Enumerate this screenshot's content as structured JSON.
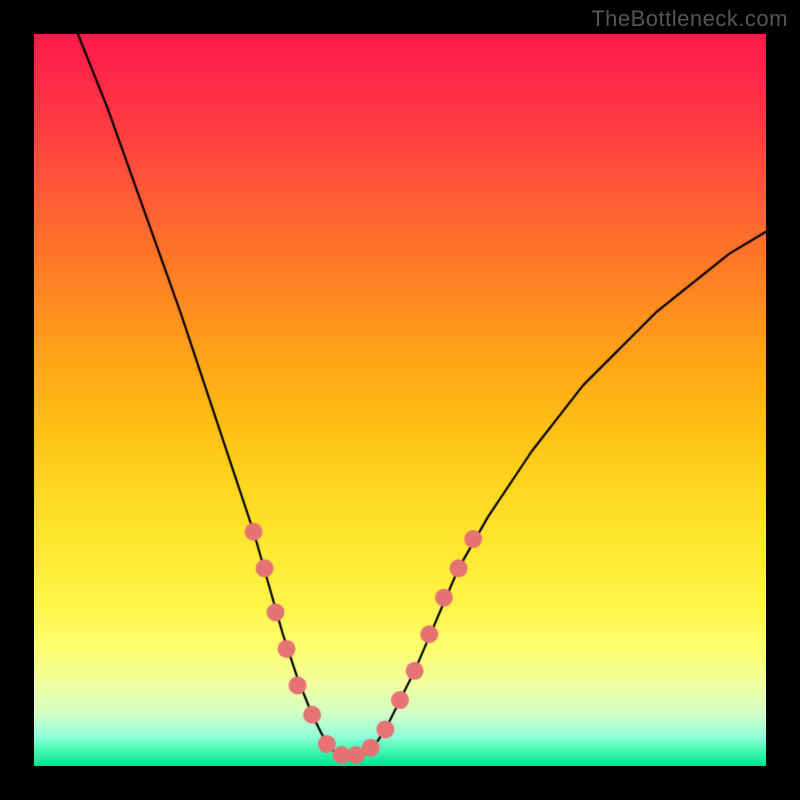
{
  "watermark": "TheBottleneck.com",
  "chart_data": {
    "type": "line",
    "title": "",
    "xlabel": "",
    "ylabel": "",
    "xlim": [
      0,
      100
    ],
    "ylim": [
      0,
      100
    ],
    "grid": false,
    "legend": false,
    "description": "V-shaped bottleneck curve over rainbow gradient (red=top/bad, green=bottom/good). Curve dips to ~0 near x≈40–45 then rises.",
    "series": [
      {
        "name": "bottleneck-curve",
        "color": "#000000",
        "x": [
          6,
          10,
          15,
          20,
          25,
          28,
          30,
          32,
          34,
          36,
          38,
          40,
          42,
          44,
          46,
          48,
          50,
          52,
          55,
          58,
          62,
          68,
          75,
          85,
          95,
          100
        ],
        "values": [
          100,
          90,
          76,
          62,
          47,
          38,
          32,
          25,
          18,
          12,
          7,
          3,
          1,
          1,
          2,
          5,
          9,
          13,
          20,
          27,
          34,
          43,
          52,
          62,
          70,
          73
        ]
      }
    ],
    "markers": {
      "name": "data-points",
      "color": "#e57373",
      "radius": 9,
      "points": [
        {
          "x": 30,
          "y": 32
        },
        {
          "x": 31.5,
          "y": 27
        },
        {
          "x": 33,
          "y": 21
        },
        {
          "x": 34.5,
          "y": 16
        },
        {
          "x": 36,
          "y": 11
        },
        {
          "x": 38,
          "y": 7
        },
        {
          "x": 40,
          "y": 3
        },
        {
          "x": 42,
          "y": 1.5
        },
        {
          "x": 44,
          "y": 1.5
        },
        {
          "x": 46,
          "y": 2.5
        },
        {
          "x": 48,
          "y": 5
        },
        {
          "x": 50,
          "y": 9
        },
        {
          "x": 52,
          "y": 13
        },
        {
          "x": 54,
          "y": 18
        },
        {
          "x": 56,
          "y": 23
        },
        {
          "x": 58,
          "y": 27
        },
        {
          "x": 60,
          "y": 31
        }
      ]
    },
    "gradient_stops": [
      {
        "pos": 0,
        "color": "#ff1a4a"
      },
      {
        "pos": 50,
        "color": "#ffc014"
      },
      {
        "pos": 85,
        "color": "#fdff70"
      },
      {
        "pos": 100,
        "color": "#00e090"
      }
    ]
  }
}
